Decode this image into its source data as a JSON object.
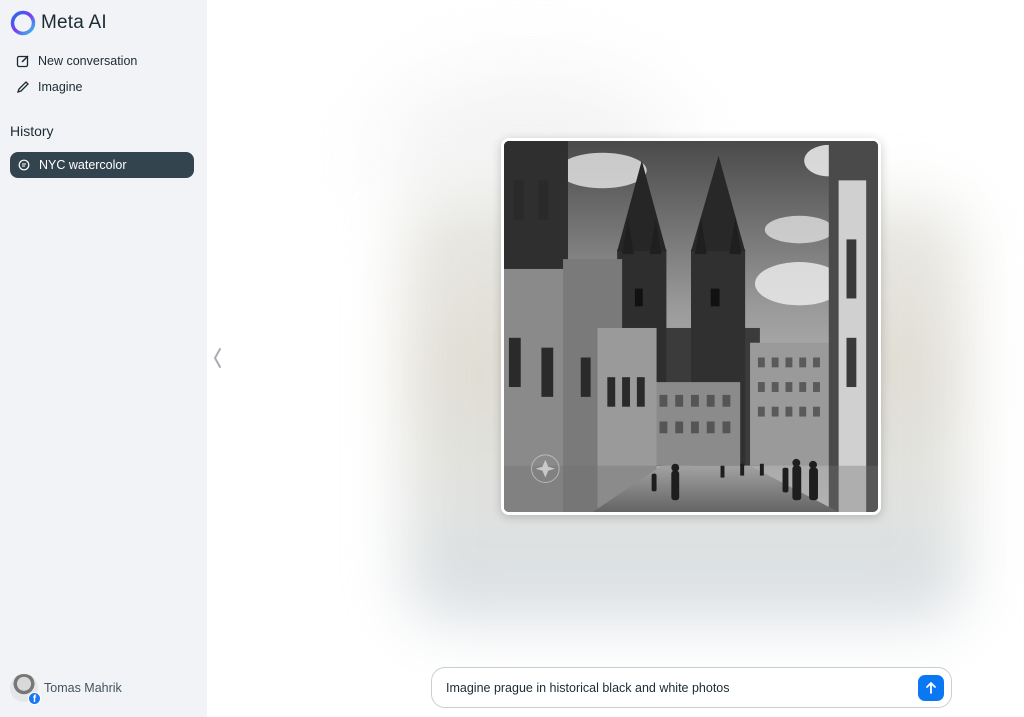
{
  "app": {
    "name": "Meta AI"
  },
  "sidebar": {
    "nav": [
      {
        "label": "New conversation",
        "icon": "edit-icon"
      },
      {
        "label": "Imagine",
        "icon": "pencil-icon"
      }
    ],
    "history_title": "History",
    "history_items": [
      {
        "label": "NYC watercolor",
        "icon": "chat-bubble-icon",
        "selected": true
      }
    ]
  },
  "profile": {
    "name": "Tomas Mahrik",
    "badge_letter": "f"
  },
  "composer": {
    "value": "Imagine prague in historical black and white photos",
    "send_icon": "arrow-up-icon"
  },
  "generated_image": {
    "subject": "Prague Old Town Square with Church of Our Lady before Týn, black and white"
  },
  "colors": {
    "sidebar_bg": "#f1f3f6",
    "selected_item_bg": "#34444f",
    "send_button": "#0a78f2",
    "facebook_blue": "#1877f2"
  }
}
